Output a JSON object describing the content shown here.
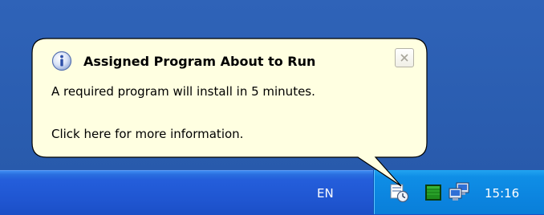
{
  "balloon": {
    "title": "Assigned Program About to Run",
    "message": "A required program will install in 5 minutes.",
    "link_text": "Click here for more information.",
    "close_symbol": "×",
    "title_icon": "info-icon",
    "background_color": "#ffffe1",
    "border_color": "#000000"
  },
  "taskbar": {
    "language": "EN",
    "clock": "15:16",
    "tray_icons": [
      "install-schedule-icon",
      "green-status-icon",
      "network-icon"
    ],
    "taskbar_color": "#245edb",
    "tray_color": "#0f8ee6"
  }
}
